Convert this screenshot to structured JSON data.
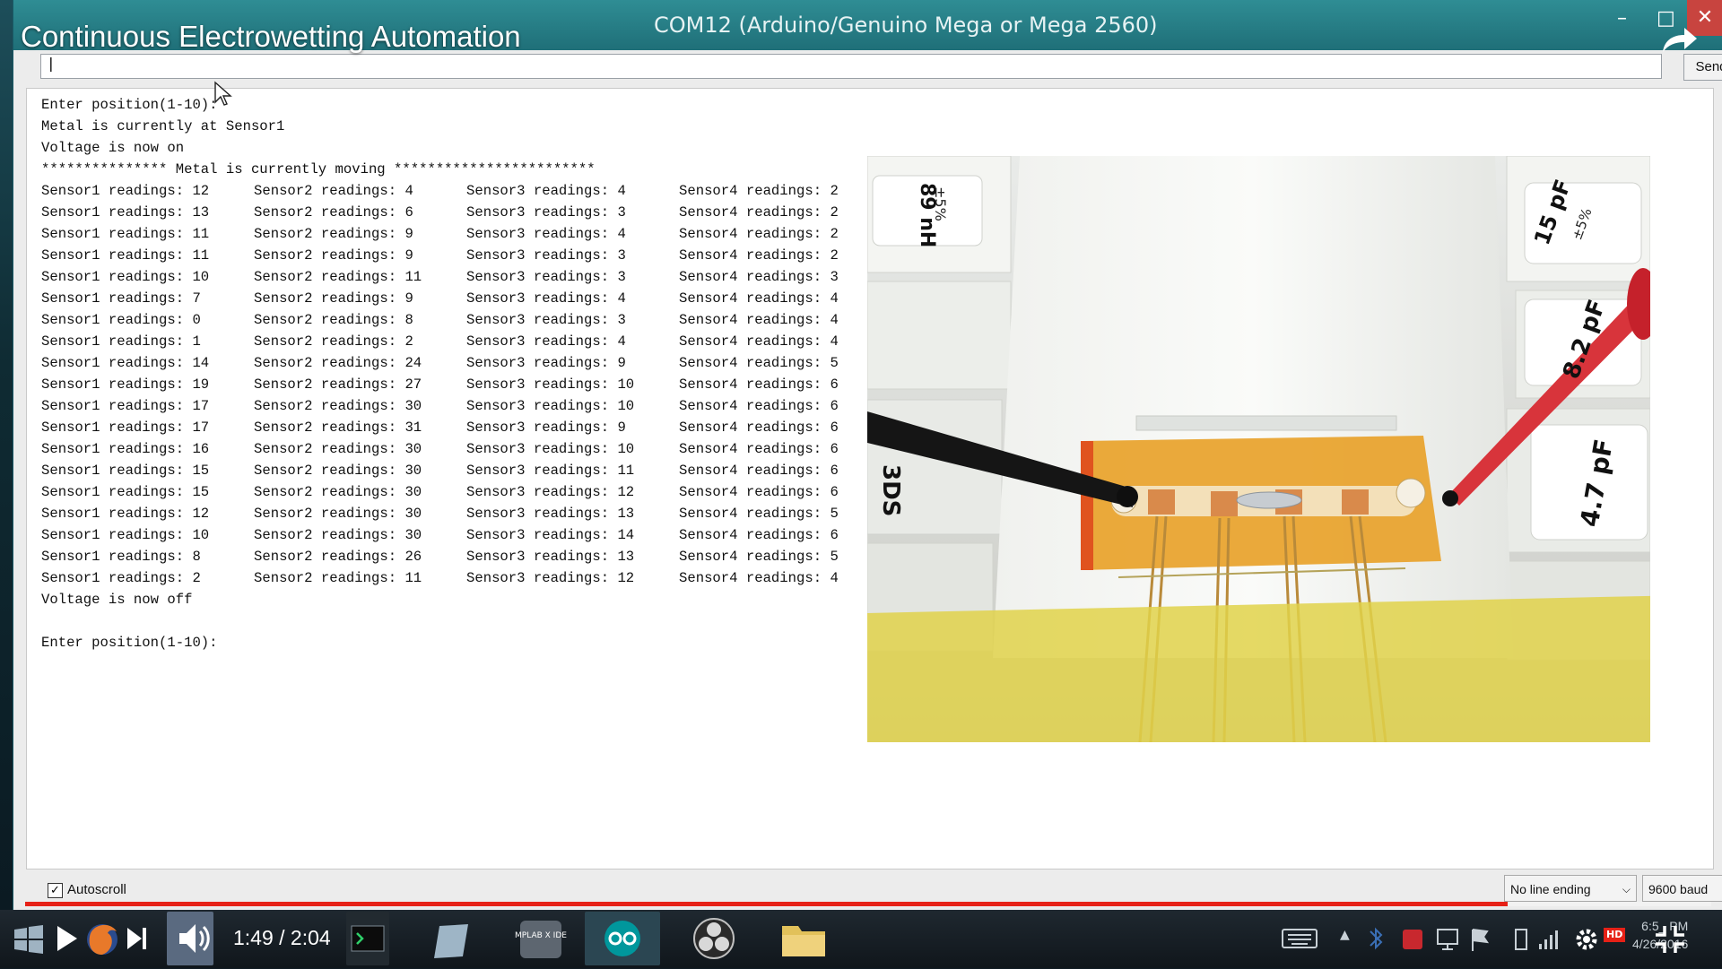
{
  "overlay": {
    "video_title": "Continuous Electrowetting Automation"
  },
  "window": {
    "title": "COM12 (Arduino/Genuino Mega or Mega 2560)",
    "minimize": "–",
    "maximize": "□",
    "close": "✕"
  },
  "input": {
    "value": "|",
    "send_label": "Send"
  },
  "console": {
    "header_lines": [
      "Enter position(1-10):",
      "Metal is currently at Sensor1",
      "Voltage is now on",
      "*************** Metal is currently moving ************************"
    ],
    "readings": [
      [
        "Sensor1 readings: 12",
        "Sensor2 readings: 4",
        "Sensor3 readings: 4",
        "Sensor4 readings: 2"
      ],
      [
        "Sensor1 readings: 13",
        "Sensor2 readings: 6",
        "Sensor3 readings: 3",
        "Sensor4 readings: 2"
      ],
      [
        "Sensor1 readings: 11",
        "Sensor2 readings: 9",
        "Sensor3 readings: 4",
        "Sensor4 readings: 2"
      ],
      [
        "Sensor1 readings: 11",
        "Sensor2 readings: 9",
        "Sensor3 readings: 3",
        "Sensor4 readings: 2"
      ],
      [
        "Sensor1 readings: 10",
        "Sensor2 readings: 11",
        "Sensor3 readings: 3",
        "Sensor4 readings: 3"
      ],
      [
        "Sensor1 readings: 7",
        "Sensor2 readings: 9",
        "Sensor3 readings: 4",
        "Sensor4 readings: 4"
      ],
      [
        "Sensor1 readings: 0",
        "Sensor2 readings: 8",
        "Sensor3 readings: 3",
        "Sensor4 readings: 4"
      ],
      [
        "Sensor1 readings: 1",
        "Sensor2 readings: 2",
        "Sensor3 readings: 4",
        "Sensor4 readings: 4"
      ],
      [
        "Sensor1 readings: 14",
        "Sensor2 readings: 24",
        "Sensor3 readings: 9",
        "Sensor4 readings: 5"
      ],
      [
        "Sensor1 readings: 19",
        "Sensor2 readings: 27",
        "Sensor3 readings: 10",
        "Sensor4 readings: 6"
      ],
      [
        "Sensor1 readings: 17",
        "Sensor2 readings: 30",
        "Sensor3 readings: 10",
        "Sensor4 readings: 6"
      ],
      [
        "Sensor1 readings: 17",
        "Sensor2 readings: 31",
        "Sensor3 readings: 9",
        "Sensor4 readings: 6"
      ],
      [
        "Sensor1 readings: 16",
        "Sensor2 readings: 30",
        "Sensor3 readings: 10",
        "Sensor4 readings: 6"
      ],
      [
        "Sensor1 readings: 15",
        "Sensor2 readings: 30",
        "Sensor3 readings: 11",
        "Sensor4 readings: 6"
      ],
      [
        "Sensor1 readings: 15",
        "Sensor2 readings: 30",
        "Sensor3 readings: 12",
        "Sensor4 readings: 6"
      ],
      [
        "Sensor1 readings: 12",
        "Sensor2 readings: 30",
        "Sensor3 readings: 13",
        "Sensor4 readings: 5"
      ],
      [
        "Sensor1 readings: 10",
        "Sensor2 readings: 30",
        "Sensor3 readings: 14",
        "Sensor4 readings: 6"
      ],
      [
        "Sensor1 readings: 8",
        "Sensor2 readings: 26",
        "Sensor3 readings: 13",
        "Sensor4 readings: 5"
      ],
      [
        "Sensor1 readings: 2",
        "Sensor2 readings: 11",
        "Sensor3 readings: 12",
        "Sensor4 readings: 4"
      ]
    ],
    "footer_lines": [
      "Voltage is now off",
      "",
      "Enter position(1-10):"
    ]
  },
  "photo": {
    "left_box_label": "89 nH",
    "left_box_sub": "±5%",
    "right_top_label": "15 pF",
    "right_top_sub": "±5%",
    "right_mid_label": "8.2 pF",
    "right_low_label": "4.7 pF",
    "left_low_label": "3DS"
  },
  "bottom": {
    "autoscroll_checked": true,
    "autoscroll_check": "✓",
    "autoscroll_label": "Autoscroll",
    "line_ending": "No line ending",
    "baud": "9600 baud"
  },
  "player": {
    "time": "1:49 / 2:04",
    "progress_fraction": 0.879,
    "hd_badge": "HD",
    "app_labels": {
      "mplab": "MPLAB X IDE"
    }
  },
  "tray": {
    "time": "6:5_ PM",
    "date": "4/26/2016"
  },
  "colors": {
    "title_bar": "#2a848c",
    "progress": "#e62117",
    "arduino": "#00979c",
    "kapton": "#e39a1c"
  }
}
